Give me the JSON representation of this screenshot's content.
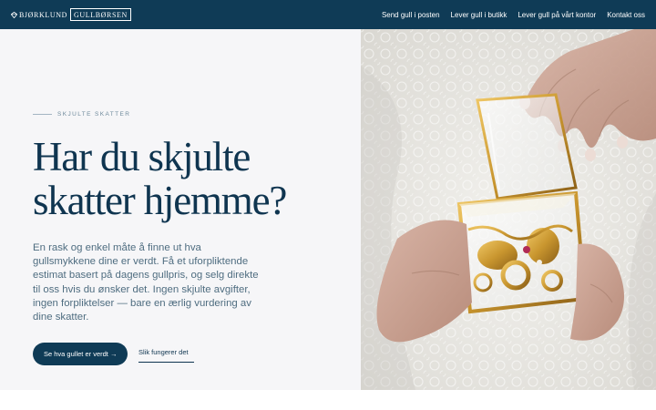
{
  "brand": {
    "name": "BJØRKLUND",
    "boxed_name": "GULLBØRSEN",
    "logo_icon": "diamond-icon"
  },
  "nav": {
    "items": [
      {
        "label": "Send gull i posten"
      },
      {
        "label": "Lever gull i butikk"
      },
      {
        "label": "Lever gull på vårt kontor"
      },
      {
        "label": "Kontakt oss"
      }
    ]
  },
  "hero": {
    "eyebrow": "SKJULTE SKATTER",
    "headline_line1": "Har du skjulte",
    "headline_line2": "skatter hjemme?",
    "lead": "En rask og enkel måte å finne ut hva gullsmykkene dine er verdt. Få et uforpliktende estimat basert på dagens gullpris, og selg direkte til oss hvis du ønsker det. Ingen skjulte avgifter, ingen forpliktelser — bare en ærlig vurdering av dine skatter.",
    "cta_primary": "Se hva gullet er verdt →",
    "cta_secondary": "Slik fungerer det",
    "image_alt_icon": "jewelry-box-photo"
  },
  "colors": {
    "navy": "#0f3b56",
    "headline": "#0f3550",
    "body_text": "#4f6d80",
    "panel_bg": "#f6f6f8",
    "gold": "#c9962f"
  }
}
